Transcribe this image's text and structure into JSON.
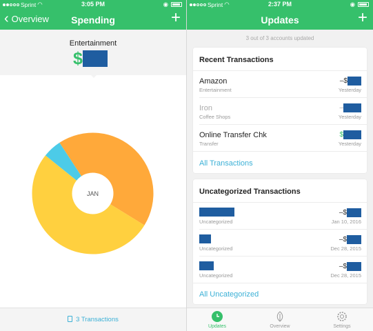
{
  "left": {
    "status": {
      "carrier": "Sprint",
      "time": "3:05 PM"
    },
    "nav": {
      "back_label": "Overview",
      "title": "Spending",
      "add": "+"
    },
    "category": {
      "name": "Entertainment",
      "currency": "$"
    },
    "donut": {
      "center_label": "JAN",
      "segments": [
        {
          "name": "orange",
          "color": "#ffa93a",
          "fraction": 0.43
        },
        {
          "name": "yellow",
          "color": "#ffd03f",
          "fraction": 0.52
        },
        {
          "name": "cyan",
          "color": "#4ccbe8",
          "fraction": 0.05
        }
      ]
    },
    "footer": {
      "label": "3 Transactions"
    }
  },
  "right": {
    "status": {
      "carrier": "Sprint",
      "time": "2:37 PM"
    },
    "nav": {
      "title": "Updates",
      "add": "+"
    },
    "summary": "3 out of 3 accounts updated",
    "recent": {
      "title": "Recent Transactions",
      "rows": [
        {
          "name": "Amazon",
          "category": "Entertainment",
          "sign": "–$",
          "date": "Yesterday"
        },
        {
          "name": "Iron",
          "category": "Coffee Shops",
          "sign": "–",
          "date": "Yesterday"
        },
        {
          "name": "Online Transfer Chk",
          "category": "Transfer",
          "sign": "$",
          "date": "Yesterday"
        }
      ],
      "link": "All Transactions"
    },
    "uncategorized": {
      "title": "Uncategorized Transactions",
      "rows": [
        {
          "category": "Uncategorized",
          "sign": "–$",
          "date": "Jan 10, 2016"
        },
        {
          "category": "Uncategorized",
          "sign": "–$",
          "date": "Dec 28, 2015"
        },
        {
          "category": "Uncategorized",
          "sign": "–$",
          "date": "Dec 28, 2015"
        }
      ],
      "link": "All Uncategorized"
    },
    "tabs": [
      {
        "label": "Updates",
        "icon": "clock-icon"
      },
      {
        "label": "Overview",
        "icon": "leaf-icon"
      },
      {
        "label": "Settings",
        "icon": "gear-icon"
      }
    ]
  },
  "colors": {
    "brand_green": "#36c06b",
    "link_blue": "#3bb0d6",
    "redaction": "#1f5da0"
  }
}
